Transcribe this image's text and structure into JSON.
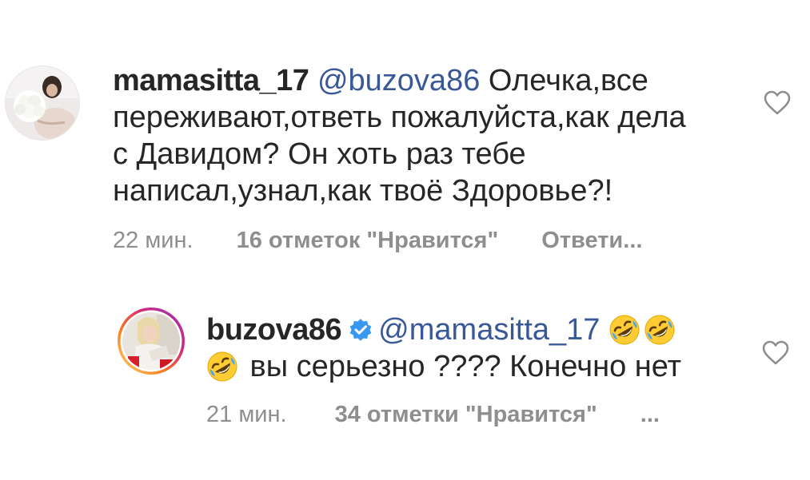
{
  "comments": [
    {
      "username": "mamasitta_17",
      "mention": "@buzova86",
      "text": " Олечка,все переживают,ответь пожалуйста,как дела с Давидом? Он хоть раз тебе написал,узнал,как твоё Здоровье?!",
      "time": "22 мин.",
      "likes": "16 отметок \"Нравится\"",
      "reply": "Ответи..."
    },
    {
      "username": "buzova86",
      "verified": true,
      "mention": "@mamasitta_17",
      "text": " вы серьезно ???? Конечно нет",
      "emojis": [
        "rolling-on-floor-laughing",
        "rolling-on-floor-laughing",
        "rolling-on-floor-laughing"
      ],
      "time": "21 мин.",
      "likes": "34 отметки \"Нравится\"",
      "more": "..."
    }
  ],
  "colors": {
    "text": "#262626",
    "meta": "#8e8e8e",
    "verified": "#3897f0",
    "mention": "#385898"
  }
}
